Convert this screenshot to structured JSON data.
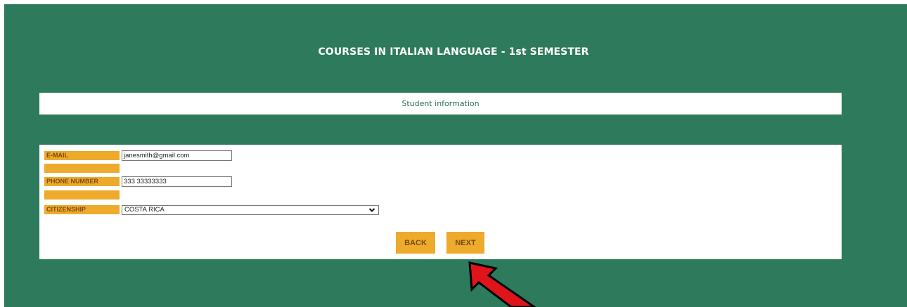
{
  "header": {
    "title": "COURSES IN ITALIAN LANGUAGE - 1st SEMESTER"
  },
  "section": {
    "title": "Student information"
  },
  "form": {
    "email_label": "E-MAIL",
    "email_value": "janesmith@gmail.com",
    "phone_label": "PHONE NUMBER",
    "phone_value": "333 33333333",
    "citizenship_label": "CITIZENSHIP",
    "citizenship_value": "COSTA RICA"
  },
  "buttons": {
    "back": "BACK",
    "next": "NEXT"
  },
  "colors": {
    "panel": "#2d7a5c",
    "label_bg": "#eeaa2b",
    "arrow": "#e0141b"
  },
  "icons": {
    "select_chevron": "chevron-down-icon",
    "annotation": "red-arrow-icon"
  }
}
